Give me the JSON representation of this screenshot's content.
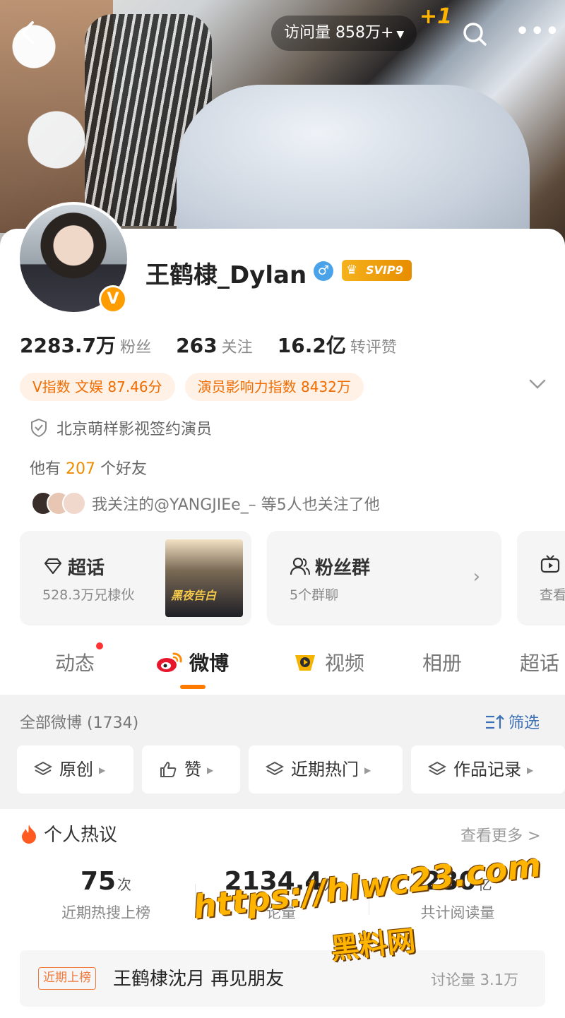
{
  "header": {
    "visits_label": "访问量 858万+",
    "plus_one": "+1",
    "back_icon": "chevron-left-icon",
    "search_icon": "search-icon",
    "more_icon": "more-icon"
  },
  "profile": {
    "name": "王鹤棣_Dylan",
    "gender_symbol": "♂",
    "svip_label": "SVIP9",
    "verified_badge": "V",
    "stats": [
      {
        "num": "2283.7万",
        "label": "粉丝"
      },
      {
        "num": "263",
        "label": "关注"
      },
      {
        "num": "16.2亿",
        "label": "转评赞"
      }
    ],
    "tags": [
      "V指数 文娱 87.46分",
      "演员影响力指数 8432万"
    ],
    "certification": "北京萌样影视签约演员",
    "friends_prefix": "他有",
    "friends_count": "207",
    "friends_suffix": "个好友",
    "mutual_follow": "我关注的@YANGJIEe_– 等5人也关注了他"
  },
  "features": [
    {
      "title": "超话",
      "sub": "528.3万兄棣伙",
      "poster_text": "黑夜告白"
    },
    {
      "title": "粉丝群",
      "sub": "5个群聊"
    },
    {
      "title": "",
      "sub": "查看"
    }
  ],
  "tabs": [
    "动态",
    "微博",
    "视频",
    "相册",
    "超话"
  ],
  "feed": {
    "all_count": "全部微博 (1734)",
    "filter_label": "筛选",
    "chips": [
      "原创",
      "赞",
      "近期热门",
      "作品记录"
    ]
  },
  "hot": {
    "title": "个人热议",
    "view_more": "查看更多 >",
    "metrics": [
      {
        "value": "75",
        "unit": "次",
        "label": "近期热搜上榜"
      },
      {
        "value": "2134.4",
        "unit": "万",
        "label": "论量"
      },
      {
        "value": "230",
        "unit": "亿",
        "label": "共计阅读量"
      }
    ],
    "row": {
      "badge": "近期上榜",
      "text": "王鹤棣沈月 再见朋友",
      "discussion": "讨论量 3.1万"
    }
  },
  "watermark": {
    "url": "https://hlwc23.com",
    "name": "黑料网"
  },
  "colors": {
    "accent": "#ff7b00",
    "tag_bg": "#fff1e6",
    "tag_text": "#f06c00",
    "link": "#3b6fb6"
  }
}
